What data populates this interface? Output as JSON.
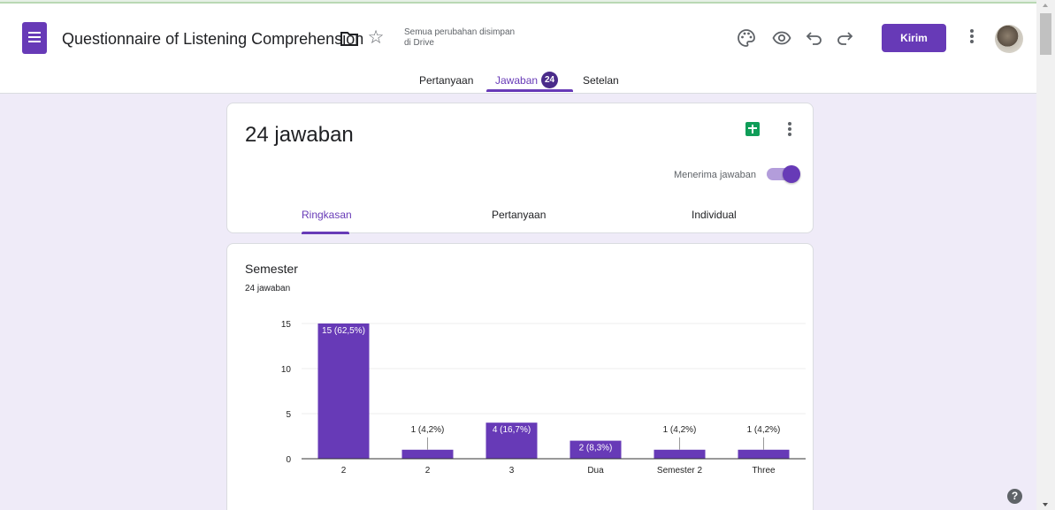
{
  "header": {
    "title": "Questionnaire of Listening Comprehension",
    "saved_status_line1": "Semua perubahan disimpan",
    "saved_status_line2": "di Drive",
    "send_label": "Kirim",
    "icons": [
      "forms-app-icon",
      "folder-icon",
      "star-icon",
      "palette-icon",
      "eye-icon",
      "undo-icon",
      "redo-icon",
      "more-vert-icon",
      "avatar"
    ]
  },
  "tabs": {
    "questions": "Pertanyaan",
    "responses": "Jawaban",
    "responses_count": "24",
    "settings": "Setelan",
    "active": "responses"
  },
  "summary_card": {
    "title": "24 jawaban",
    "accepting_label": "Menerima jawaban",
    "accepting": true,
    "subtabs": [
      "Ringkasan",
      "Pertanyaan",
      "Individual"
    ],
    "active_subtab": "Ringkasan"
  },
  "question_card": {
    "title": "Semester",
    "responses": "24 jawaban"
  },
  "colors": {
    "accent": "#673ab7",
    "bar": "#673ab7",
    "background": "#efebf8",
    "sheets": "#0f9d58"
  },
  "chart_data": {
    "type": "bar",
    "title": "Semester",
    "categories": [
      "2",
      "2",
      "3",
      "Dua",
      "Semester 2",
      "Three"
    ],
    "values": [
      15,
      1,
      4,
      2,
      1,
      1
    ],
    "labels": [
      "15 (62,5%)",
      "1 (4,2%)",
      "4 (16,7%)",
      "2 (8,3%)",
      "1 (4,2%)",
      "1 (4,2%)"
    ],
    "yticks": [
      "0",
      "5",
      "10",
      "15"
    ],
    "ylim": [
      0,
      15
    ],
    "grid": true
  }
}
